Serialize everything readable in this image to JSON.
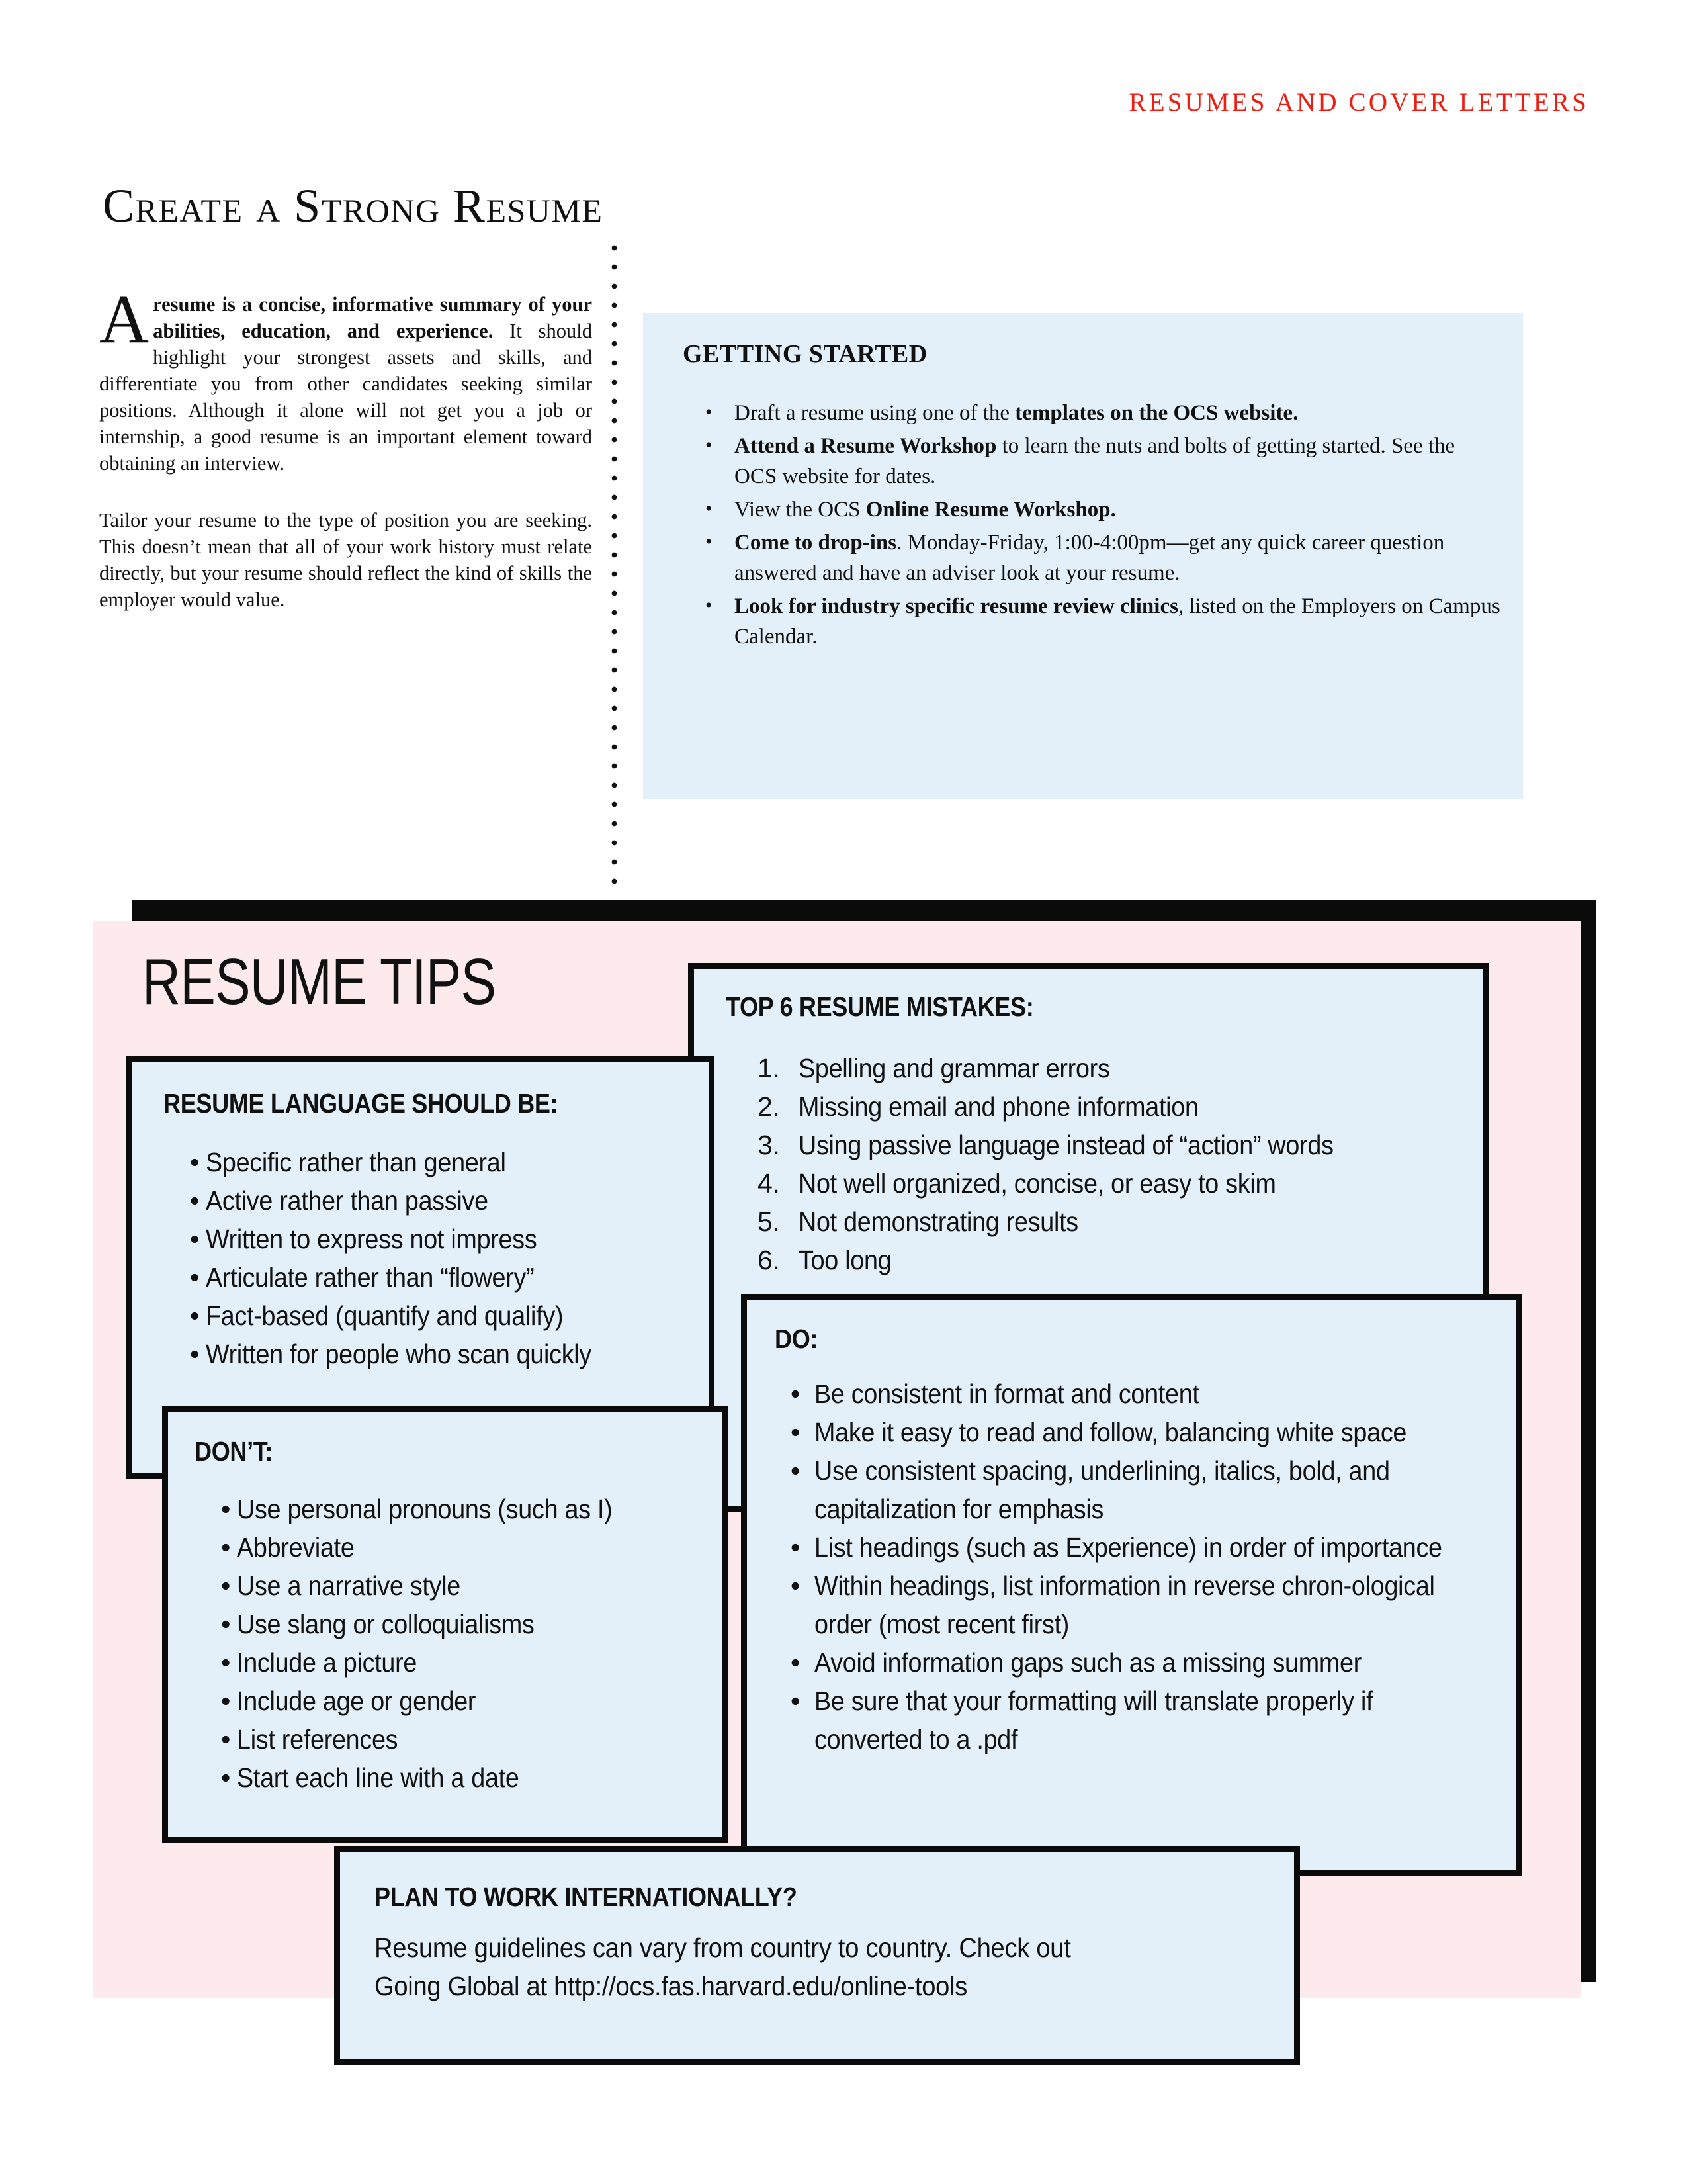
{
  "header": {
    "kicker": "RESUMES AND COVER LETTERS",
    "title": "Create a Strong Resume"
  },
  "colors": {
    "accent_red": "#ee1c11",
    "panel_blue": "#e3f0fa",
    "panel_pink": "#fdeaec",
    "frame_black": "#0b0b0b"
  },
  "intro": {
    "dropcap": "A",
    "lead": "resume is a concise, informative summary of your abilities, education, and experience.",
    "para1_rest": " It should highlight your strongest assets and skills, and differentiate you from other candidates seeking similar positions. Although it alone will not get you a job or internship, a good resume is an important element toward obtaining an interview.",
    "para2": "Tailor your resume to the type of position you are seeking. This doesn’t mean that all of your work history must relate directly, but your resume should reflect the kind of skills the employer would value."
  },
  "getting_started": {
    "title": "GETTING STARTED",
    "bullet_glyph": "•",
    "items": [
      {
        "plain_before": "Draft a resume using one of the ",
        "bold": "templates on the OCS website.",
        "plain_after": ""
      },
      {
        "plain_before": "",
        "bold": "Attend a Resume Workshop",
        "plain_after": " to learn the nuts and bolts of getting started. See the OCS website for dates."
      },
      {
        "plain_before": "View the OCS ",
        "bold": "Online Resume Workshop.",
        "plain_after": ""
      },
      {
        "plain_before": "",
        "bold": "Come to drop-ins",
        "plain_after": ". Monday-Friday, 1:00-4:00pm—get any quick career question answered and have an adviser look at your resume."
      },
      {
        "plain_before": "",
        "bold": "Look for industry specific resume review clinics",
        "plain_after": ", listed on the Employers on Campus Calendar."
      }
    ]
  },
  "tips": {
    "heading": "RESUME TIPS",
    "bullet_glyph": "•",
    "mistakes": {
      "title": "TOP 6 RESUME MISTAKES:",
      "items": [
        "Spelling and grammar errors",
        "Missing email and phone information",
        "Using passive language instead of “action” words",
        "Not well organized, concise, or easy to skim",
        "Not demonstrating results",
        "Too long"
      ]
    },
    "language": {
      "title": "RESUME LANGUAGE SHOULD BE:",
      "items": [
        "Specific rather than general",
        "Active rather than passive",
        "Written to express not impress",
        "Articulate rather than “flowery”",
        "Fact-based (quantify and qualify)",
        "Written for people who scan quickly"
      ]
    },
    "dont": {
      "title": "DON’T:",
      "items": [
        "Use personal pronouns (such as I)",
        "Abbreviate",
        "Use a narrative style",
        "Use slang or colloquialisms",
        "Include a picture",
        "Include age or gender",
        "List references",
        "Start each line with a date"
      ]
    },
    "do": {
      "title": "DO:",
      "items": [
        "Be consistent in format and content",
        "Make it easy to read and follow, balancing white space",
        "Use consistent spacing, underlining, italics, bold, and capitalization for emphasis",
        "List headings (such as Experience) in order of importance",
        "Within headings, list information in reverse chron-ological order (most recent first)",
        "Avoid information gaps such as a missing summer",
        "Be sure that your formatting will translate properly if converted to a .pdf"
      ]
    },
    "international": {
      "title": "PLAN TO WORK INTERNATIONALLY?",
      "line1": "Resume guidelines can vary from country to country. Check out",
      "line2": "Going Global at http://ocs.fas.harvard.edu/online-tools"
    }
  }
}
